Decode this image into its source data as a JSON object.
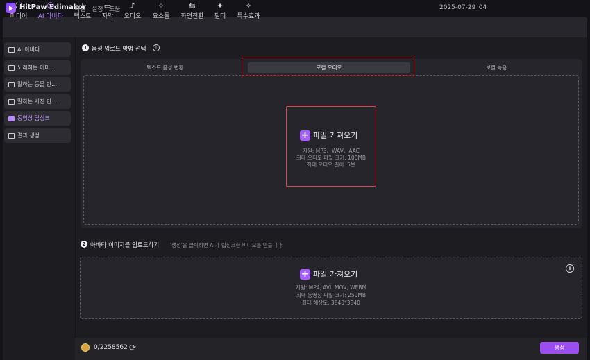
{
  "app": {
    "name": "HitPaw Edimakor",
    "menu": [
      "파일",
      "설정",
      "도움"
    ],
    "date": "2025-07-29_04"
  },
  "toolbar": {
    "tabs": [
      {
        "label": "미디어",
        "icon": "media-icon"
      },
      {
        "label": "AI 아바타",
        "icon": "avatar-icon",
        "active": true
      },
      {
        "label": "텍스트",
        "icon": "text-icon"
      },
      {
        "label": "자막",
        "icon": "subtitle-icon"
      },
      {
        "label": "오디오",
        "icon": "audio-icon"
      },
      {
        "label": "요소들",
        "icon": "elements-icon"
      },
      {
        "label": "화면전환",
        "icon": "transition-icon"
      },
      {
        "label": "필터",
        "icon": "filter-icon"
      },
      {
        "label": "특수효과",
        "icon": "effects-icon"
      }
    ]
  },
  "sidebar": {
    "items": [
      {
        "label": "AI 아바타"
      },
      {
        "label": "노래하는 이미..."
      },
      {
        "label": "말하는 동물 만..."
      },
      {
        "label": "말하는 사진 만..."
      },
      {
        "label": "동영상 립싱크",
        "active": true
      },
      {
        "label": "결과 생성"
      }
    ]
  },
  "step1": {
    "num": "1",
    "title": "음성 업로드 방법 선택",
    "tabs": [
      "텍스트 음성 변환",
      "로컬 오디오",
      "보컬 녹음"
    ],
    "active_tab": 1,
    "upload_label": "파일 가져오기",
    "specs": [
      "지원: MP3、WAV、AAC",
      "최대 오디오 파일 크기: 100MB",
      "최대 오디오 길이: 5분"
    ]
  },
  "step2": {
    "num": "2",
    "title": "아바타 이미지를 업로드하기",
    "hint": "'생성'을 클릭하면 AI가 립싱크한 비디오를 만듭니다.",
    "upload_label": "파일 가져오기",
    "specs": [
      "지원: MP4, AVI, MOV, WEBM",
      "최대 동영상 파일 크기: 250MB",
      "최대 해상도: 3840*3840"
    ]
  },
  "footer": {
    "credits": "0/2258562",
    "generate_label": "생성"
  },
  "colors": {
    "accent": "#a65cff",
    "highlight": "#e2433f"
  }
}
